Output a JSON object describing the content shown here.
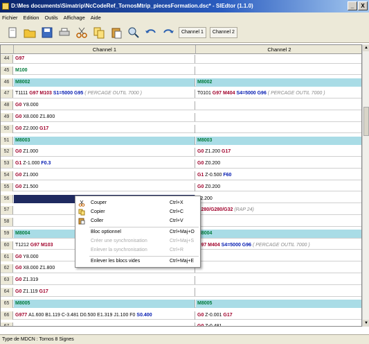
{
  "window": {
    "title": "D:\\Mes documents\\Simatrip\\NcCodeRef_TornosMtrip_piecesFormation.dsc* - SIEdtor (1.1.0)",
    "min": "_",
    "close": "X"
  },
  "menu": [
    "Fichier",
    "Edition",
    "Outils",
    "Affichage",
    "Aide"
  ],
  "toolbar": {
    "channel1": "Channel 1",
    "channel2": "Channel 2"
  },
  "grid": {
    "headers": {
      "c1": "Channel 1",
      "c2": "Channel 2"
    },
    "rows": [
      {
        "n": "44",
        "c1": [
          [
            "G97",
            "red"
          ]
        ],
        "c2": []
      },
      {
        "n": "45",
        "c1": [
          [
            "M100",
            "grn"
          ]
        ],
        "c2": []
      },
      {
        "n": "46",
        "hl": true,
        "c1": [
          [
            "M8002",
            "grn"
          ]
        ],
        "c2": [
          [
            "M8002",
            "grn"
          ]
        ]
      },
      {
        "n": "47",
        "c1": [
          [
            "T1111 ",
            ""
          ],
          [
            "G97 M103 ",
            "red"
          ],
          [
            "S1=5000 G95",
            "blu"
          ],
          [
            " ( PERCAGE OUTIL 7000 )",
            "cmt"
          ]
        ],
        "c2": [
          [
            "T0101 ",
            ""
          ],
          [
            "G97 M404 ",
            "red"
          ],
          [
            "S4=5000 G96",
            "blu"
          ],
          [
            " ( PERCAGE OUTIL 7000 )",
            "cmt"
          ]
        ]
      },
      {
        "n": "48",
        "c1": [
          [
            "G0 ",
            "red"
          ],
          [
            "Y8.000",
            ""
          ]
        ],
        "c2": []
      },
      {
        "n": "49",
        "c1": [
          [
            "G0 ",
            "red"
          ],
          [
            "X8.000 Z1.800",
            ""
          ]
        ],
        "c2": []
      },
      {
        "n": "50",
        "c1": [
          [
            "G0 ",
            "red"
          ],
          [
            "Z2.000 ",
            ""
          ],
          [
            "G17",
            "red"
          ]
        ],
        "c2": []
      },
      {
        "n": "51",
        "hl": true,
        "c1": [
          [
            "M8003",
            "grn"
          ]
        ],
        "c2": [
          [
            "M8003",
            "grn"
          ]
        ]
      },
      {
        "n": "52",
        "c1": [
          [
            "G0 ",
            "red"
          ],
          [
            "Z1.000",
            ""
          ]
        ],
        "c2": [
          [
            "G0 ",
            "red"
          ],
          [
            "Z1.200 ",
            ""
          ],
          [
            "G17",
            "red"
          ]
        ]
      },
      {
        "n": "53",
        "c1": [
          [
            "G1 ",
            "red"
          ],
          [
            "Z-1.000 ",
            ""
          ],
          [
            "F0.3",
            "blu"
          ]
        ],
        "c2": [
          [
            "G0 ",
            "red"
          ],
          [
            "Z0.200",
            ""
          ]
        ]
      },
      {
        "n": "54",
        "c1": [
          [
            "G0 ",
            "red"
          ],
          [
            "Z1.000",
            ""
          ]
        ],
        "c2": [
          [
            "G1 ",
            "red"
          ],
          [
            "Z-0.500 ",
            ""
          ],
          [
            "F60",
            "blu"
          ]
        ]
      },
      {
        "n": "55",
        "c1": [
          [
            "G0 ",
            "red"
          ],
          [
            "Z1.500",
            ""
          ]
        ],
        "c2": [
          [
            "G0 ",
            "red"
          ],
          [
            "Z0.200",
            ""
          ]
        ]
      },
      {
        "n": "56",
        "sel": true,
        "c1": [],
        "c2": [
          [
            "Z2.200",
            ""
          ]
        ]
      },
      {
        "n": "57",
        "c1": [],
        "c2": [
          [
            "G280/G280/G32",
            "red"
          ],
          [
            " (RAP 24)",
            "cmt"
          ]
        ]
      },
      {
        "n": "58",
        "c1": [],
        "c2": []
      },
      {
        "n": "59",
        "hl": true,
        "c1": [
          [
            "M8004",
            "grn"
          ]
        ],
        "c2": [
          [
            "M8004",
            "grn"
          ]
        ]
      },
      {
        "n": "60",
        "c1": [
          [
            "T1212 ",
            ""
          ],
          [
            "G97 M103",
            "red"
          ]
        ],
        "c2": [
          [
            "G97 M404 ",
            "red"
          ],
          [
            "S4=5000 G96",
            "blu"
          ],
          [
            " ( PERCAGE OUTIL 7000 )",
            "cmt"
          ]
        ]
      },
      {
        "n": "61",
        "c1": [
          [
            "G0 ",
            "red"
          ],
          [
            "Y8.000",
            ""
          ]
        ],
        "c2": []
      },
      {
        "n": "62",
        "c1": [
          [
            "G0 ",
            "red"
          ],
          [
            "X8.000 Z1.800",
            ""
          ]
        ],
        "c2": []
      },
      {
        "n": "63",
        "c1": [
          [
            "G0 ",
            "red"
          ],
          [
            "Z1.319",
            ""
          ]
        ],
        "c2": []
      },
      {
        "n": "64",
        "c1": [
          [
            "G0 ",
            "red"
          ],
          [
            "Z1.119 ",
            ""
          ],
          [
            "G17",
            "red"
          ]
        ],
        "c2": []
      },
      {
        "n": "65",
        "hl": true,
        "c1": [
          [
            "M8005",
            "grn"
          ]
        ],
        "c2": [
          [
            "M8005",
            "grn"
          ]
        ]
      },
      {
        "n": "66",
        "c1": [
          [
            "G977 ",
            "red"
          ],
          [
            "A1.600 B1.119 C-3.481 D0.500 E1.319 J1.100 F0 ",
            ""
          ],
          [
            "S0.400",
            "blu"
          ]
        ],
        "c2": [
          [
            "G0 ",
            "red"
          ],
          [
            "Z-0.001 ",
            ""
          ],
          [
            "G17",
            "red"
          ]
        ]
      },
      {
        "n": "67",
        "c1": [],
        "c2": [
          [
            "G0 ",
            "red"
          ],
          [
            "Z-0.481",
            ""
          ]
        ]
      }
    ]
  },
  "context_menu": [
    {
      "label": "Couper",
      "shortcut": "Ctrl+X",
      "icon": "scissors-icon"
    },
    {
      "label": "Copier",
      "shortcut": "Ctrl+C",
      "icon": "copy-icon"
    },
    {
      "label": "Coller",
      "shortcut": "Ctrl+V",
      "icon": "paste-icon"
    },
    {
      "label": "Bloc optionnel",
      "shortcut": "Ctrl+Maj+O"
    },
    {
      "label": "Créer une synchronisation",
      "shortcut": "Ctrl+Maj+S",
      "disabled": true
    },
    {
      "label": "Enlever la synchronisation",
      "shortcut": "Ctrl+R",
      "disabled": true
    },
    {
      "label": "Enlever les blocs vides",
      "shortcut": "Ctrl+Maj+E"
    }
  ],
  "status": {
    "text": "Type de MDCN : Tornos 8 Signes"
  }
}
